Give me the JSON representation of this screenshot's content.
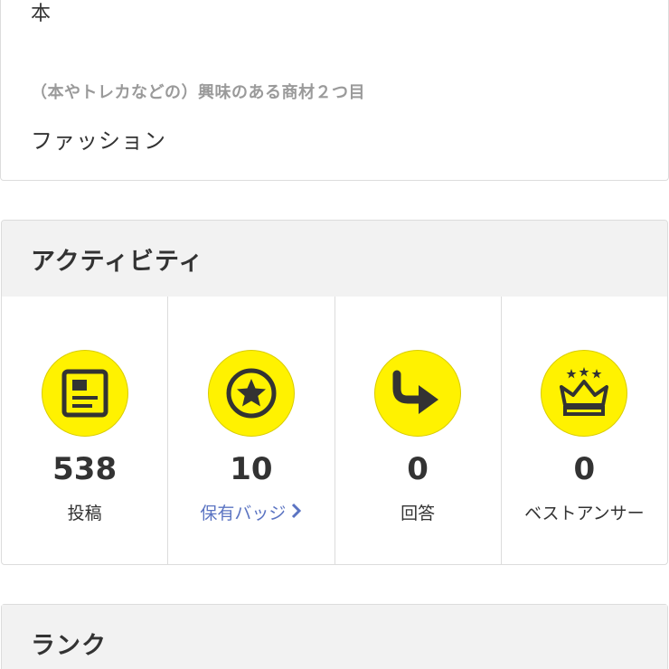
{
  "profile": {
    "field_1_value": "本",
    "field_2_label": "（本やトレカなどの）興味のある商材２つ目",
    "field_2_value": "ファッション"
  },
  "activity": {
    "title": "アクティビティ",
    "stats": [
      {
        "icon": "post-document-icon",
        "value": "538",
        "label": "投稿"
      },
      {
        "icon": "badge-star-icon",
        "value": "10",
        "label": "保有バッジ"
      },
      {
        "icon": "answer-arrow-icon",
        "value": "0",
        "label": "回答"
      },
      {
        "icon": "crown-icon",
        "value": "0",
        "label": "ベストアンサー"
      }
    ]
  },
  "rank": {
    "title": "ランク"
  },
  "colors": {
    "icon_bg": "#fff200",
    "link": "#5b74c2",
    "header_bg": "#f2f2f2"
  }
}
